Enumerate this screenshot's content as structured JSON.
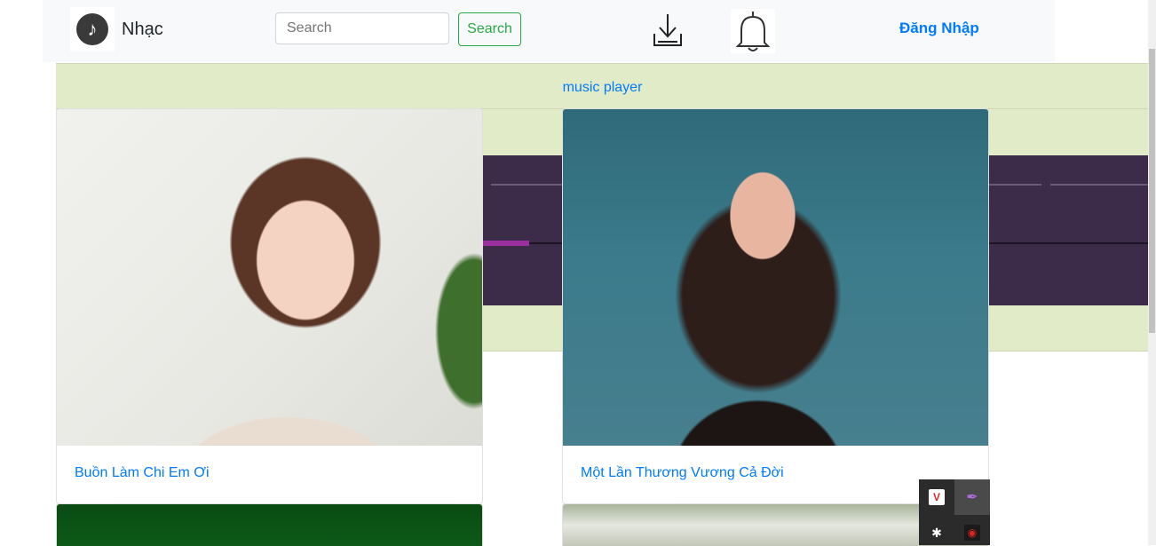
{
  "navbar": {
    "brand_name": "Nhạc",
    "brand_icon": "music-note-icon",
    "search_placeholder": "Search",
    "search_button": "Search",
    "download_icon": "download-icon",
    "bell_icon": "bell-icon",
    "login_label": "Đăng Nhập"
  },
  "player": {
    "link_label": "music player",
    "progress": 0.07,
    "accent_color": "#9b2fa0",
    "background_color": "#3d2b4a"
  },
  "songs": [
    {
      "title": "Buồn Làm Chi Em Ơi"
    },
    {
      "title": "Một Lần Thương Vương Cả Đời"
    },
    {
      "title": ""
    },
    {
      "title": ""
    }
  ],
  "tray": {
    "icons": [
      "vivaldi-icon",
      "feather-pen-icon",
      "slack-icon",
      "game-controller-icon"
    ]
  },
  "colors": {
    "link": "#007bff",
    "success": "#28a745",
    "player_section_bg": "#e2ebc8"
  }
}
